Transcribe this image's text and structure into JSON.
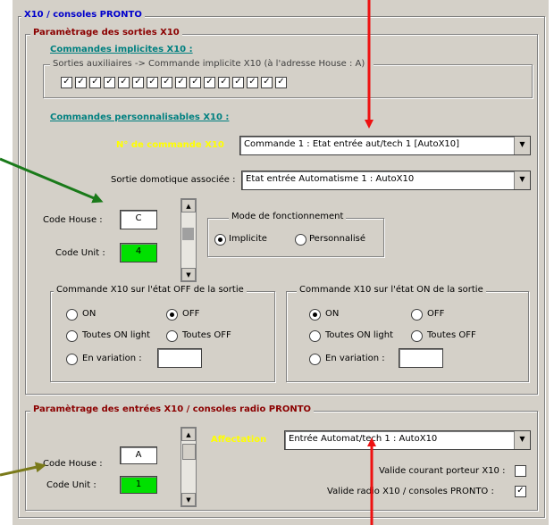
{
  "outer_title": "X10 / consoles PRONTO",
  "sorties": {
    "title": "Paramètrage des sorties X10",
    "implicites": {
      "title": "Commandes implicites X10 :",
      "group_label": "Sorties auxiliaires -> Commande implicite X10  (à l'adresse House : A) :",
      "checkbox_count": 16,
      "checked": true
    },
    "personnalisables": {
      "title": "Commandes personnalisables X10 :",
      "num_label": "N° de commande X10",
      "num_value": "Commande 1 : Etat entrée aut/tech 1 [AutoX10]",
      "sortie_label": "Sortie domotique associée :",
      "sortie_value": "Etat entrée Automatisme 1 : AutoX10"
    },
    "code_house_label": "Code House :",
    "code_house_value": "C",
    "code_unit_label": "Code Unit :",
    "code_unit_value": "4",
    "mode": {
      "title": "Mode de fonctionnement",
      "implicite": "Implicite",
      "personnalise": "Personnalisé",
      "selected": "implicite"
    },
    "off_group": {
      "title": "Commande X10 sur l'état OFF de la sortie",
      "on": "ON",
      "off": "OFF",
      "toutes_on": "Toutes ON light",
      "toutes_off": "Toutes OFF",
      "variation": "En variation :",
      "selected": "off"
    },
    "on_group": {
      "title": "Commande X10 sur l'état ON de la sortie",
      "on": "ON",
      "off": "OFF",
      "toutes_on": "Toutes ON light",
      "toutes_off": "Toutes OFF",
      "variation": "En variation :",
      "selected": "on"
    }
  },
  "entrees": {
    "title": "Paramètrage des entrées X10 / consoles radio PRONTO",
    "code_house_label": "Code House :",
    "code_house_value": "A",
    "code_unit_label": "Code Unit :",
    "code_unit_value": "1",
    "affectation_label": "Affectation",
    "affectation_value": "Entrée Automat/tech 1 : AutoX10",
    "valide_courant": "Valide courant porteur X10 :",
    "valide_courant_checked": false,
    "valide_radio": "Valide radio X10 / consoles PRONTO :",
    "valide_radio_checked": true
  },
  "colors": {
    "red_arrow": "#ee1111",
    "green_arrow": "#1a7a1a",
    "olive_arrow": "#7a7a1a"
  }
}
